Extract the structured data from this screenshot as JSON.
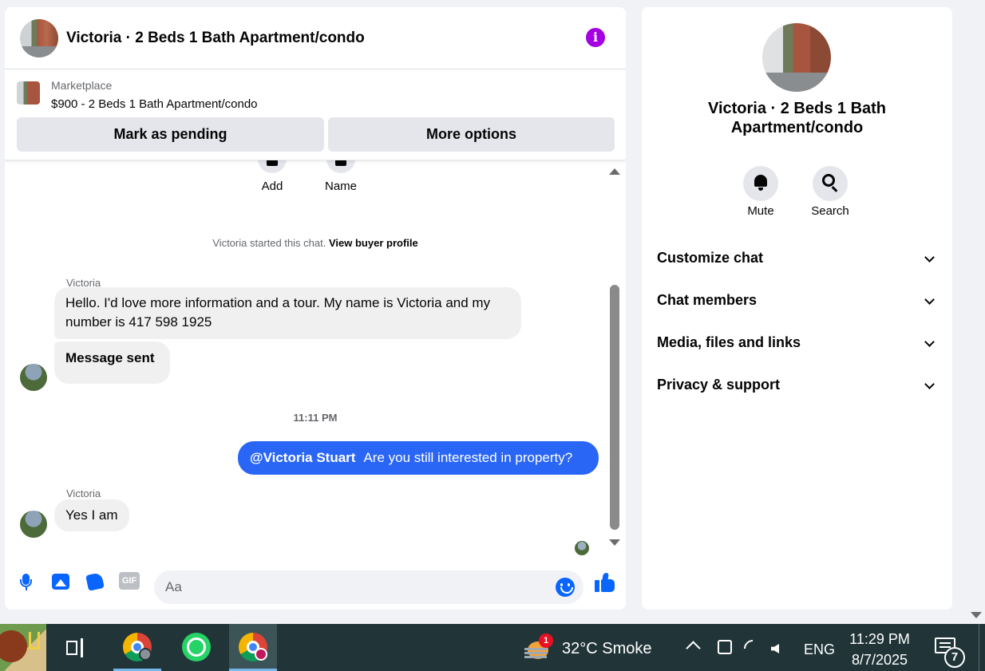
{
  "chat": {
    "title": "Victoria · 2 Beds 1 Bath Apartment/condo",
    "info_icon": "info-icon",
    "marketplace": {
      "label": "Marketplace",
      "listing": "$900 - 2 Beds 1 Bath Apartment/condo",
      "pending_label": "Mark as pending",
      "more_label": "More options"
    },
    "actions": {
      "add_label": "Add",
      "name_label": "Name"
    },
    "started": {
      "text": "Victoria started this chat.",
      "link": "View buyer profile"
    },
    "messages": [
      {
        "sender": "Victoria",
        "text": "Hello. I'd love more information and a tour. My name is Victoria and my number is 417 598 1925"
      },
      {
        "text": "Message sent"
      },
      {
        "time": "11:11 PM"
      },
      {
        "mention": "@Victoria Stuart",
        "text": "Are you still interested in property?"
      },
      {
        "sender": "Victoria",
        "text": "Yes I am"
      }
    ],
    "composer": {
      "placeholder": "Aa"
    }
  },
  "info": {
    "title": "Victoria · 2 Beds 1 Bath Apartment/condo",
    "mute_label": "Mute",
    "search_label": "Search",
    "sections": [
      "Customize chat",
      "Chat members",
      "Media, files and links",
      "Privacy & support"
    ]
  },
  "taskbar": {
    "weather_badge": "1",
    "weather": "32°C  Smoke",
    "language": "ENG",
    "time": "11:29 PM",
    "date": "8/7/2025",
    "notification_count": "7"
  },
  "colors": {
    "accent": "#0866ff",
    "outgoing_bubble": "#2a66f5",
    "info_icon": "#a400e1",
    "taskbar": "#213539"
  }
}
